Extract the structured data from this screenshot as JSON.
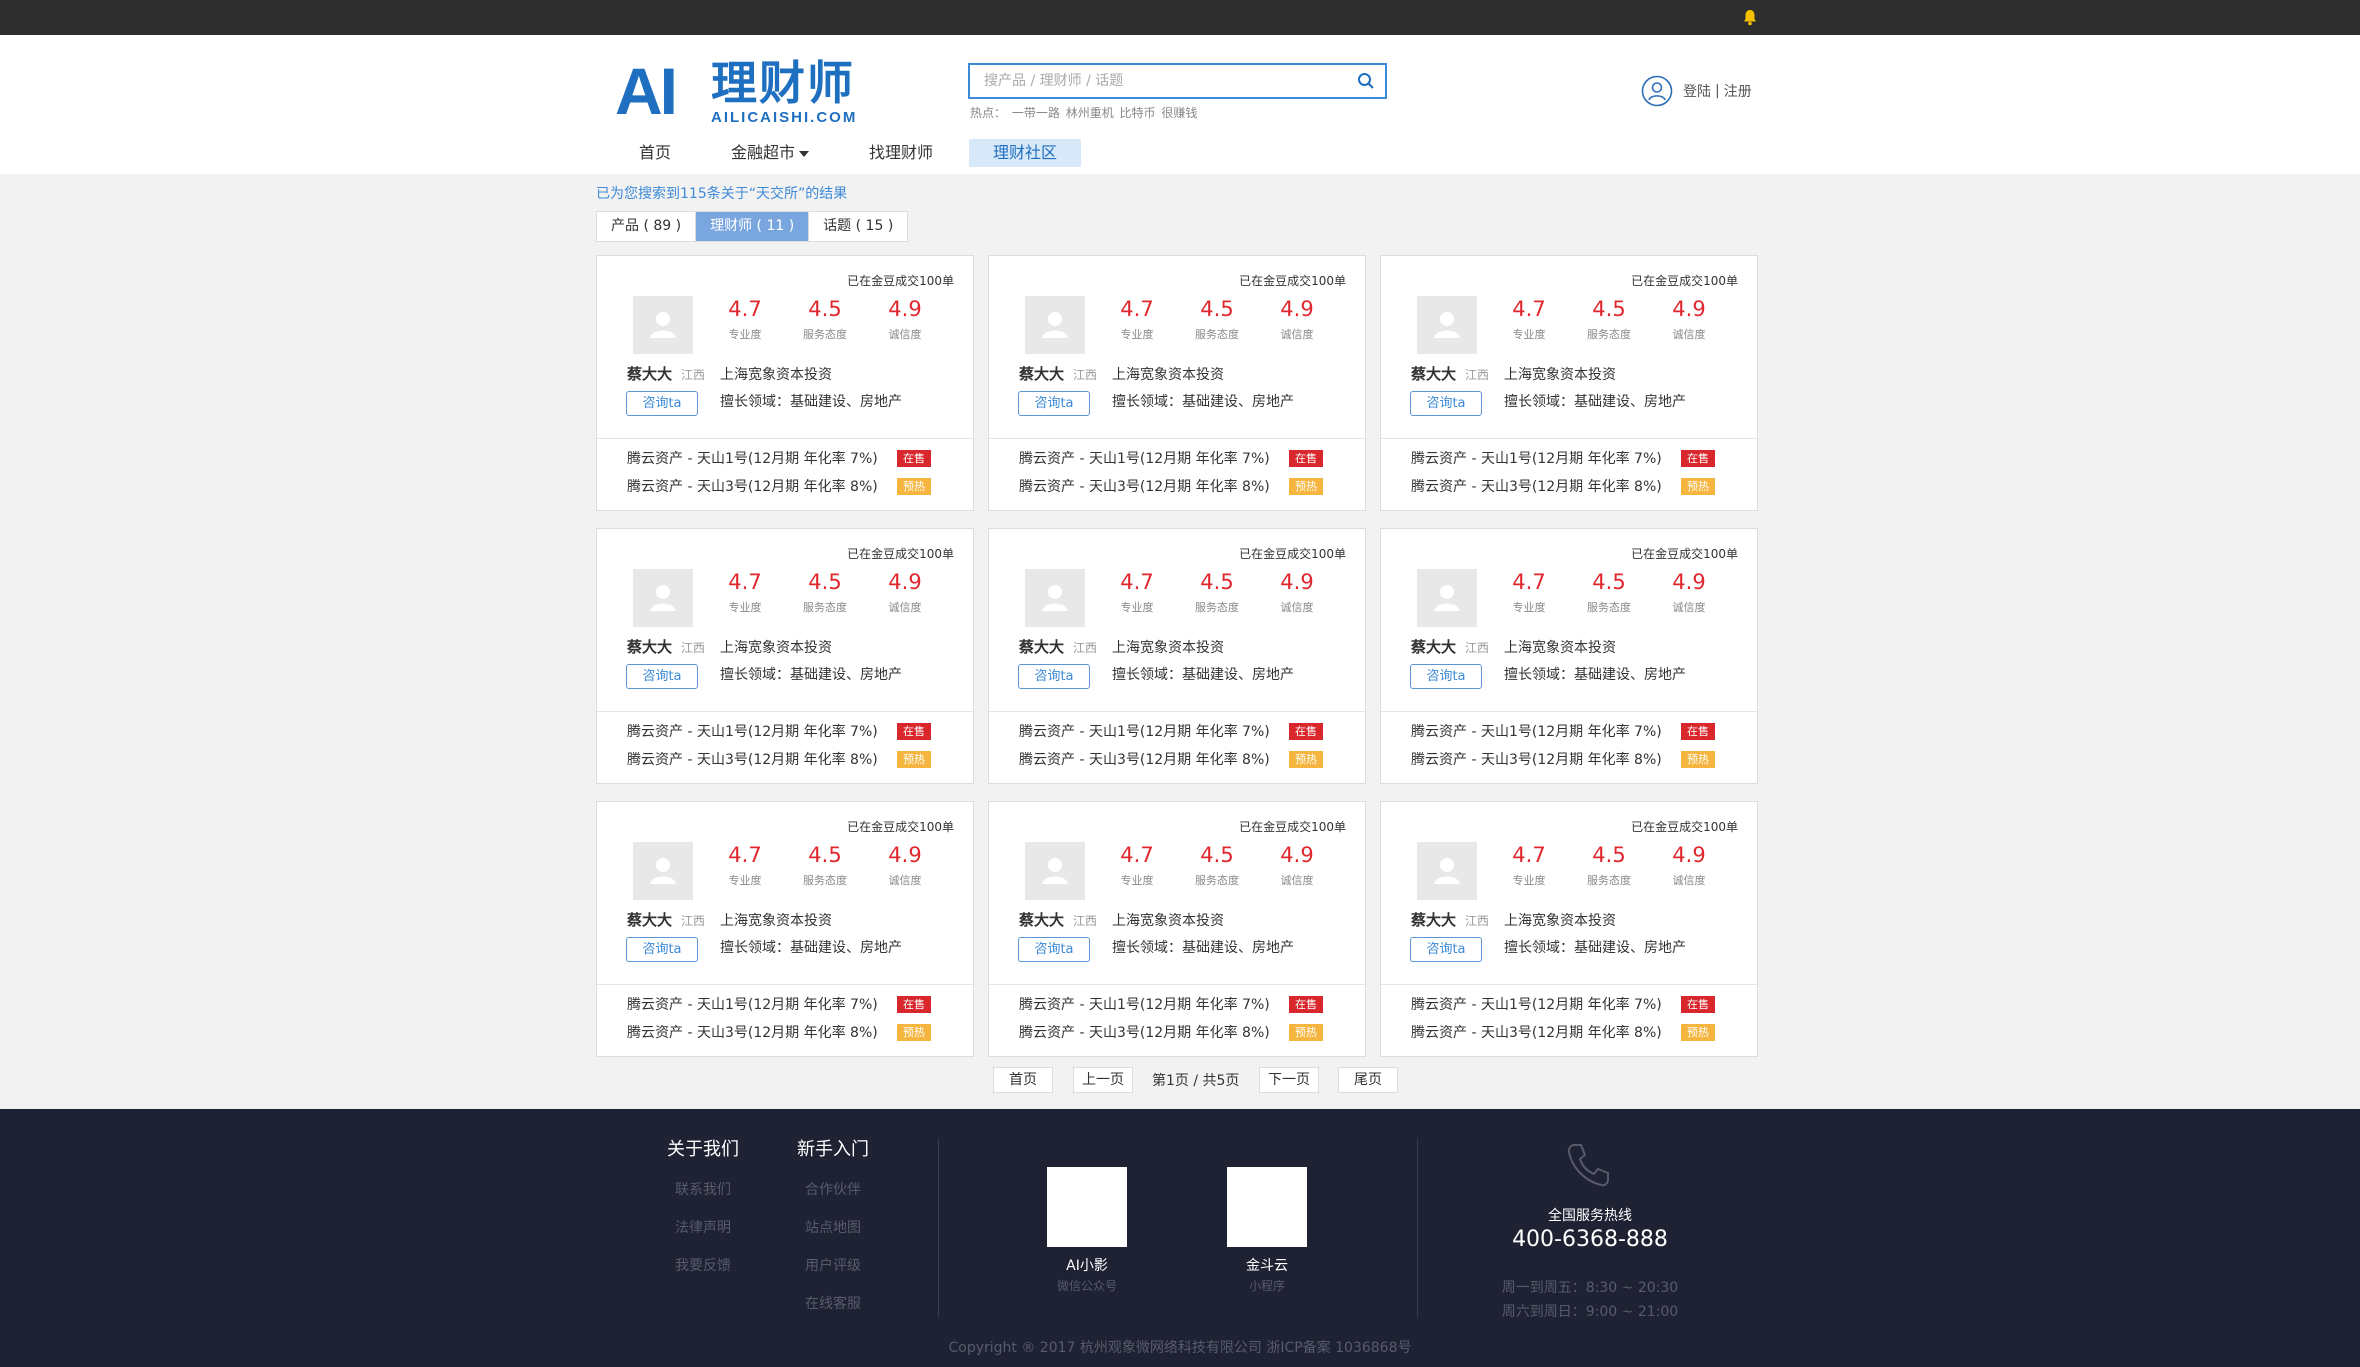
{
  "logo": {
    "mark": "AI",
    "cn": "理财师",
    "en": "AILICAISHI.COM"
  },
  "search": {
    "placeholder": "搜产品 / 理财师 / 话题",
    "hot_label": "热点：",
    "hot_terms": [
      "一带一路",
      "林州重机",
      "比特币",
      "很赚钱"
    ]
  },
  "user": {
    "login": "登陆",
    "separator": "|",
    "register": "注册"
  },
  "nav": [
    {
      "label": "首页"
    },
    {
      "label": "金融超市"
    },
    {
      "label": "找理财师"
    },
    {
      "label": "理财社区"
    }
  ],
  "result_text": "已为您搜索到115条关于“天交所”的结果",
  "tabs": [
    {
      "label": "产品 ( 89 )"
    },
    {
      "label": "理财师 ( 11 )"
    },
    {
      "label": "话题 ( 15 )"
    }
  ],
  "cards": [
    {
      "deals": "已在金豆成交100单",
      "ratings": [
        {
          "v": "4.7",
          "l": "专业度"
        },
        {
          "v": "4.5",
          "l": "服务态度"
        },
        {
          "v": "4.9",
          "l": "诚信度"
        }
      ],
      "name": "蔡大大",
      "province": "江西",
      "company": "上海宽象资本投资",
      "consult": "咨询ta",
      "field": "擅长领域：基础建设、房地产",
      "products": [
        {
          "name": "腾云资产 - 天山1号(12月期 年化率 7%)",
          "badge": "在售"
        },
        {
          "name": "腾云资产 - 天山3号(12月期 年化率 8%)",
          "badge": "预热"
        }
      ]
    },
    {
      "deals": "已在金豆成交100单",
      "ratings": [
        {
          "v": "4.7",
          "l": "专业度"
        },
        {
          "v": "4.5",
          "l": "服务态度"
        },
        {
          "v": "4.9",
          "l": "诚信度"
        }
      ],
      "name": "蔡大大",
      "province": "江西",
      "company": "上海宽象资本投资",
      "consult": "咨询ta",
      "field": "擅长领域：基础建设、房地产",
      "products": [
        {
          "name": "腾云资产 - 天山1号(12月期 年化率 7%)",
          "badge": "在售"
        },
        {
          "name": "腾云资产 - 天山3号(12月期 年化率 8%)",
          "badge": "预热"
        }
      ]
    },
    {
      "deals": "已在金豆成交100单",
      "ratings": [
        {
          "v": "4.7",
          "l": "专业度"
        },
        {
          "v": "4.5",
          "l": "服务态度"
        },
        {
          "v": "4.9",
          "l": "诚信度"
        }
      ],
      "name": "蔡大大",
      "province": "江西",
      "company": "上海宽象资本投资",
      "consult": "咨询ta",
      "field": "擅长领域：基础建设、房地产",
      "products": [
        {
          "name": "腾云资产 - 天山1号(12月期 年化率 7%)",
          "badge": "在售"
        },
        {
          "name": "腾云资产 - 天山3号(12月期 年化率 8%)",
          "badge": "预热"
        }
      ]
    },
    {
      "deals": "已在金豆成交100单",
      "ratings": [
        {
          "v": "4.7",
          "l": "专业度"
        },
        {
          "v": "4.5",
          "l": "服务态度"
        },
        {
          "v": "4.9",
          "l": "诚信度"
        }
      ],
      "name": "蔡大大",
      "province": "江西",
      "company": "上海宽象资本投资",
      "consult": "咨询ta",
      "field": "擅长领域：基础建设、房地产",
      "products": [
        {
          "name": "腾云资产 - 天山1号(12月期 年化率 7%)",
          "badge": "在售"
        },
        {
          "name": "腾云资产 - 天山3号(12月期 年化率 8%)",
          "badge": "预热"
        }
      ]
    },
    {
      "deals": "已在金豆成交100单",
      "ratings": [
        {
          "v": "4.7",
          "l": "专业度"
        },
        {
          "v": "4.5",
          "l": "服务态度"
        },
        {
          "v": "4.9",
          "l": "诚信度"
        }
      ],
      "name": "蔡大大",
      "province": "江西",
      "company": "上海宽象资本投资",
      "consult": "咨询ta",
      "field": "擅长领域：基础建设、房地产",
      "products": [
        {
          "name": "腾云资产 - 天山1号(12月期 年化率 7%)",
          "badge": "在售"
        },
        {
          "name": "腾云资产 - 天山3号(12月期 年化率 8%)",
          "badge": "预热"
        }
      ]
    },
    {
      "deals": "已在金豆成交100单",
      "ratings": [
        {
          "v": "4.7",
          "l": "专业度"
        },
        {
          "v": "4.5",
          "l": "服务态度"
        },
        {
          "v": "4.9",
          "l": "诚信度"
        }
      ],
      "name": "蔡大大",
      "province": "江西",
      "company": "上海宽象资本投资",
      "consult": "咨询ta",
      "field": "擅长领域：基础建设、房地产",
      "products": [
        {
          "name": "腾云资产 - 天山1号(12月期 年化率 7%)",
          "badge": "在售"
        },
        {
          "name": "腾云资产 - 天山3号(12月期 年化率 8%)",
          "badge": "预热"
        }
      ]
    },
    {
      "deals": "已在金豆成交100单",
      "ratings": [
        {
          "v": "4.7",
          "l": "专业度"
        },
        {
          "v": "4.5",
          "l": "服务态度"
        },
        {
          "v": "4.9",
          "l": "诚信度"
        }
      ],
      "name": "蔡大大",
      "province": "江西",
      "company": "上海宽象资本投资",
      "consult": "咨询ta",
      "field": "擅长领域：基础建设、房地产",
      "products": [
        {
          "name": "腾云资产 - 天山1号(12月期 年化率 7%)",
          "badge": "在售"
        },
        {
          "name": "腾云资产 - 天山3号(12月期 年化率 8%)",
          "badge": "预热"
        }
      ]
    },
    {
      "deals": "已在金豆成交100单",
      "ratings": [
        {
          "v": "4.7",
          "l": "专业度"
        },
        {
          "v": "4.5",
          "l": "服务态度"
        },
        {
          "v": "4.9",
          "l": "诚信度"
        }
      ],
      "name": "蔡大大",
      "province": "江西",
      "company": "上海宽象资本投资",
      "consult": "咨询ta",
      "field": "擅长领域：基础建设、房地产",
      "products": [
        {
          "name": "腾云资产 - 天山1号(12月期 年化率 7%)",
          "badge": "在售"
        },
        {
          "name": "腾云资产 - 天山3号(12月期 年化率 8%)",
          "badge": "预热"
        }
      ]
    },
    {
      "deals": "已在金豆成交100单",
      "ratings": [
        {
          "v": "4.7",
          "l": "专业度"
        },
        {
          "v": "4.5",
          "l": "服务态度"
        },
        {
          "v": "4.9",
          "l": "诚信度"
        }
      ],
      "name": "蔡大大",
      "province": "江西",
      "company": "上海宽象资本投资",
      "consult": "咨询ta",
      "field": "擅长领域：基础建设、房地产",
      "products": [
        {
          "name": "腾云资产 - 天山1号(12月期 年化率 7%)",
          "badge": "在售"
        },
        {
          "name": "腾云资产 - 天山3号(12月期 年化率 8%)",
          "badge": "预热"
        }
      ]
    }
  ],
  "pager": {
    "first": "首页",
    "prev": "上一页",
    "info": "第1页 / 共5页",
    "next": "下一页",
    "last": "尾页"
  },
  "footer": {
    "about_title": "关于我们",
    "about_links": [
      "联系我们",
      "法律声明",
      "我要反馈"
    ],
    "newbie_title": "新手入门",
    "newbie_links": [
      "合作伙伴",
      "站点地图",
      "用户评级",
      "在线客服"
    ],
    "qr": [
      {
        "name": "AI小影",
        "sub": "微信公众号"
      },
      {
        "name": "金斗云",
        "sub": "小程序"
      }
    ],
    "hotline_title": "全国服务热线",
    "hotline": "400-6368-888",
    "hours": [
      "周一到周五：8:30 ~ 20:30",
      "周六到周日：9:00 ~ 21:00"
    ],
    "copyright": "Copyright ® 2017 杭州观象微网络科技有限公司 浙ICP备案 1036868号"
  },
  "colors": {
    "brand": "#1f6fc1",
    "rating": "#e0272e",
    "on_sale": "#d9272e",
    "preheat": "#f5b53f",
    "footer_bg": "#1f2233"
  }
}
